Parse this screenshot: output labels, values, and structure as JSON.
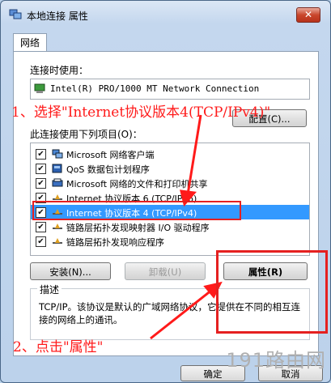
{
  "window": {
    "title": "本地连接 属性",
    "close_label": "✕"
  },
  "tabs": [
    {
      "label": "网络"
    }
  ],
  "connect_using_label": "连接时使用：",
  "adapter_name": "Intel(R) PRO/1000 MT Network Connection",
  "configure_button": "配置(C)...",
  "items_label": "此连接使用下列项目(O)：",
  "items": [
    {
      "label": "Microsoft 网络客户端",
      "checked": true,
      "selected": false,
      "icon": "network-client-icon"
    },
    {
      "label": "QoS 数据包计划程序",
      "checked": true,
      "selected": false,
      "icon": "qos-scheduler-icon"
    },
    {
      "label": "Microsoft 网络的文件和打印机共享",
      "checked": true,
      "selected": false,
      "icon": "file-printer-sharing-icon"
    },
    {
      "label": "Internet 协议版本 6 (TCP/IPv6)",
      "checked": true,
      "selected": false,
      "icon": "protocol-icon"
    },
    {
      "label": "Internet 协议版本 4 (TCP/IPv4)",
      "checked": true,
      "selected": true,
      "icon": "protocol-icon"
    },
    {
      "label": "链路层拓扑发现映射器 I/O 驱动程序",
      "checked": true,
      "selected": false,
      "icon": "protocol-icon"
    },
    {
      "label": "链路层拓扑发现响应程序",
      "checked": true,
      "selected": false,
      "icon": "protocol-icon"
    }
  ],
  "install_button": "安装(N)...",
  "uninstall_button": "卸载(U)",
  "properties_button": "属性(R)",
  "description_label": "描述",
  "description_text": "TCP/IP。该协议是默认的广域网络协议，它提供在不同的相互连接的网络上的通讯。",
  "ok_button": "确定",
  "cancel_button": "取消",
  "annotations": {
    "step1": "1、选择\"Internet协议版本4(TCP/IPv4)\"",
    "step2": "2、点击\"属性\"",
    "color": "#ff1a1a"
  },
  "watermark": "191路由网"
}
